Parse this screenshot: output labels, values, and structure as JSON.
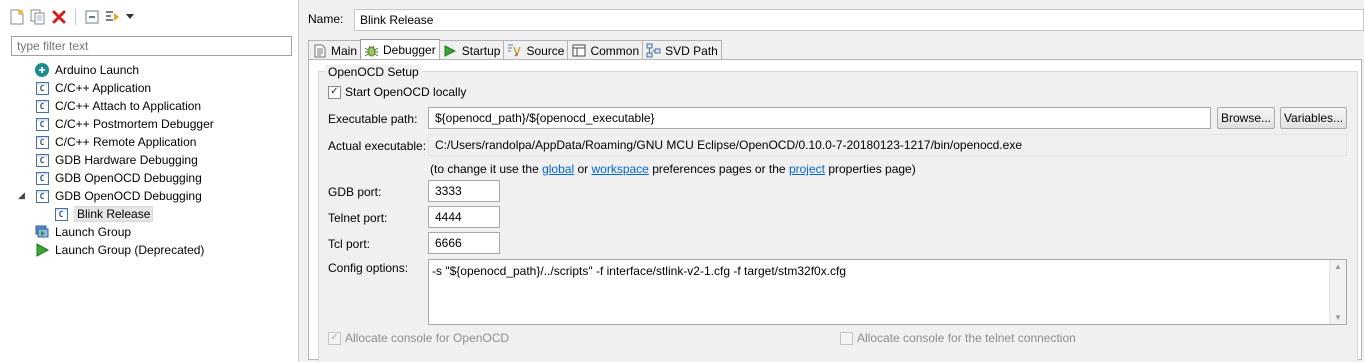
{
  "toolbar": {
    "icons": [
      "new-config-icon",
      "duplicate-icon",
      "delete-icon",
      "collapse-all-icon",
      "filter-icon",
      "dropdown-arrow-icon"
    ]
  },
  "filter": {
    "placeholder": "type filter text"
  },
  "tree": {
    "items": [
      {
        "label": "Arduino Launch",
        "icon": "arduino-icon",
        "level": 1
      },
      {
        "label": "C/C++ Application",
        "icon": "c-file-icon",
        "level": 1
      },
      {
        "label": "C/C++ Attach to Application",
        "icon": "c-file-icon",
        "level": 1
      },
      {
        "label": "C/C++ Postmortem Debugger",
        "icon": "c-file-icon",
        "level": 1
      },
      {
        "label": "C/C++ Remote Application",
        "icon": "c-file-icon",
        "level": 1
      },
      {
        "label": "GDB Hardware Debugging",
        "icon": "c-file-icon",
        "level": 1
      },
      {
        "label": "GDB OpenOCD Debugging",
        "icon": "c-file-icon",
        "level": 1
      },
      {
        "label": "GDB OpenOCD Debugging",
        "icon": "c-file-icon",
        "level": 1,
        "expanded": true
      },
      {
        "label": "Blink Release",
        "icon": "c-file-icon",
        "level": 2,
        "selected": true
      },
      {
        "label": "Launch Group",
        "icon": "launch-group-icon",
        "level": 1
      },
      {
        "label": "Launch Group (Deprecated)",
        "icon": "launch-arrow-icon",
        "level": 1
      }
    ]
  },
  "name": {
    "label": "Name:",
    "value": "Blink Release"
  },
  "tabs": [
    {
      "label": "Main",
      "icon": "main-tab-icon"
    },
    {
      "label": "Debugger",
      "icon": "debugger-bug-icon",
      "active": true
    },
    {
      "label": "Startup",
      "icon": "startup-play-icon"
    },
    {
      "label": "Source",
      "icon": "source-icon"
    },
    {
      "label": "Common",
      "icon": "common-icon"
    },
    {
      "label": "SVD Path",
      "icon": "svd-path-icon"
    }
  ],
  "openocd": {
    "group_title": "OpenOCD Setup",
    "start_locally": {
      "label": "Start OpenOCD locally",
      "checked": true
    },
    "executable_path": {
      "label": "Executable path:",
      "value": "${openocd_path}/${openocd_executable}"
    },
    "browse_label": "Browse...",
    "variables_label": "Variables...",
    "actual_executable": {
      "label": "Actual executable:",
      "value": "C:/Users/randolpa/AppData/Roaming/GNU MCU Eclipse/OpenOCD/0.10.0-7-20180123-1217/bin/openocd.exe"
    },
    "hint": {
      "prefix": "(to change it use the",
      "global": "global",
      "or": "or",
      "workspace": "workspace",
      "middle": "preferences pages or the",
      "project": "project",
      "suffix": "properties page)"
    },
    "gdb_port": {
      "label": "GDB port:",
      "value": "3333"
    },
    "telnet_port": {
      "label": "Telnet port:",
      "value": "4444"
    },
    "tcl_port": {
      "label": "Tcl port:",
      "value": "6666"
    },
    "config_options": {
      "label": "Config options:",
      "value": "-s \"${openocd_path}/../scripts\" -f interface/stlink-v2-1.cfg -f target/stm32f0x.cfg"
    },
    "allocate_console": {
      "label": "Allocate console for OpenOCD",
      "checked": true,
      "enabled": false
    },
    "allocate_telnet": {
      "label": "Allocate console for the telnet connection",
      "checked": false,
      "enabled": false
    }
  },
  "colors": {
    "link": "#0066cc",
    "selection": "#e5e5e5",
    "panel_bg": "#f0f0f0"
  }
}
